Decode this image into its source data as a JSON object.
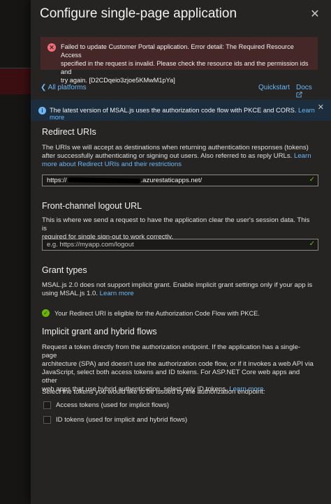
{
  "header": {
    "title": "Configure single-page application",
    "close_glyph": "✕"
  },
  "error": {
    "icon_glyph": "✕",
    "line1": "Failed to update Customer Portal application. Error detail: The Required Resource Access",
    "line2": "specified in the request is invalid. Please check the resource ids and the permission ids and",
    "line3": "try again. [D2CDqeio3zjoe5KMwM1pYa]"
  },
  "nav": {
    "back_label": "All platforms",
    "quickstart_label": "Quickstart",
    "docs_label": "Docs"
  },
  "info": {
    "icon_glyph": "i",
    "text": "The latest version of MSAL.js uses the authorization code flow with PKCE and CORS.",
    "link": "Learn more",
    "close_glyph": "✕"
  },
  "redirect": {
    "title": "Redirect URIs",
    "line1": "The URIs we will accept as destinations when returning authentication responses (tokens)",
    "line2_text": "after successfully authenticating or signing out users. Also referred to as reply URLs.",
    "line2_link": "Learn",
    "line3_link": "more about Redirect URIs and their restrictions",
    "value_prefix": "https://",
    "value_suffix": ".azurestaticapps.net/",
    "check_glyph": "✓"
  },
  "logout": {
    "title": "Front-channel logout URL",
    "line1": "This is where we send a request to have the application clear the user's session data. This is",
    "line2": "required for single sign-out to work correctly.",
    "placeholder": "e.g. https://myapp.com/logout",
    "check_glyph": "✓"
  },
  "grant": {
    "title": "Grant types",
    "line1": "MSAL.js 2.0 does not support implicit grant. Enable implicit grant settings only if your app is",
    "line2_text": "using MSAL.js 1.0.",
    "line2_link": "Learn more",
    "success_glyph": "✓",
    "success_text": "Your Redirect URI is eligible for the Authorization Code Flow with PKCE."
  },
  "implicit": {
    "title": "Implicit grant and hybrid flows",
    "line1": "Request a token directly from the authorization endpoint. If the application has a single-page",
    "line2": "architecture (SPA) and doesn't use the authorization code flow, or if it invokes a web API via",
    "line3": "JavaScript, select both access tokens and ID tokens. For ASP.NET Core web apps and other",
    "line4_text": "web apps that use hybrid authentication, select only ID tokens.",
    "line4_link": "Learn more.",
    "select_prompt": "Select the tokens you would like to be issued by the authorization endpoint:",
    "access_tokens_label": "Access tokens (used for implicit flows)",
    "id_tokens_label": "ID tokens (used for implicit and hybrid flows)"
  },
  "colors": {
    "link": "#6cb8f6",
    "error_bg": "#442726",
    "info_bg": "#1c2e3e",
    "success": "#6bb700"
  }
}
